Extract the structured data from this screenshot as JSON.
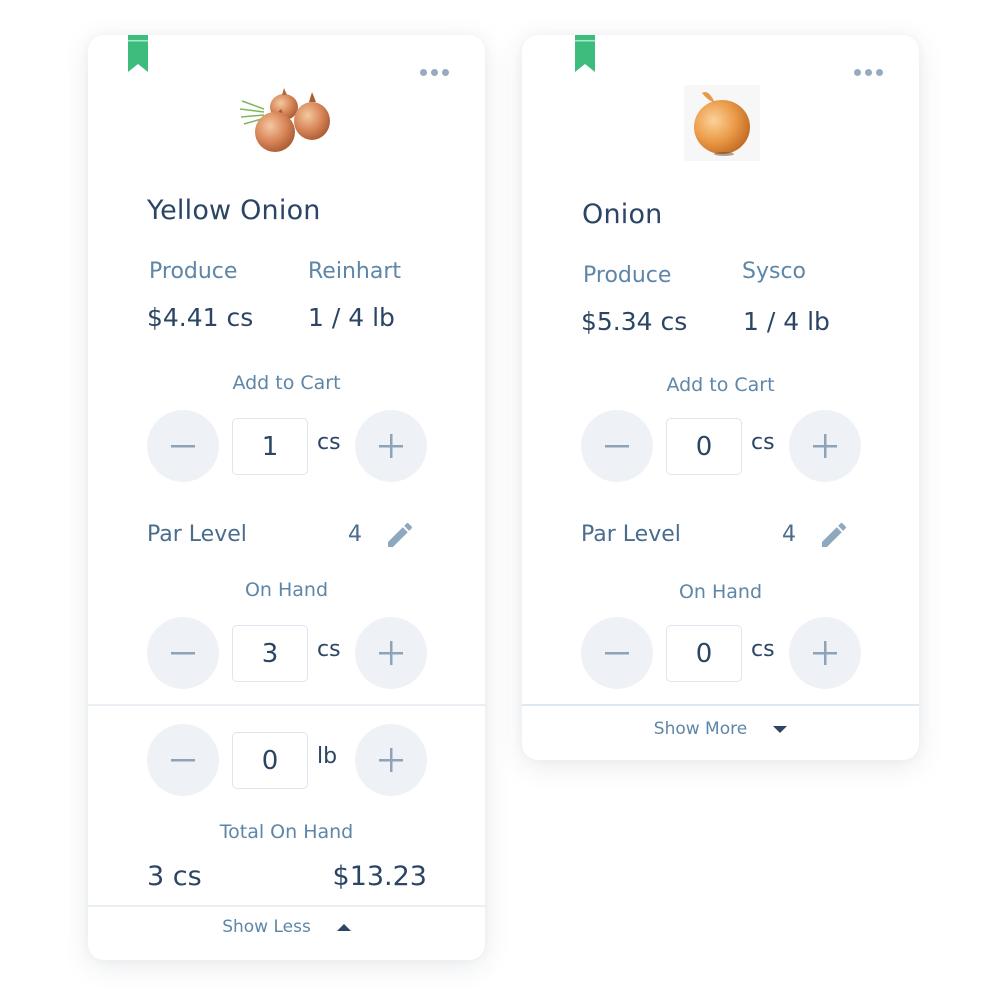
{
  "colors": {
    "bookmark": "#3dbd7d",
    "text_dark": "#2c4565",
    "text_label": "#5d86a8",
    "button_bg": "#eef2f6",
    "icon_muted": "#97abc0"
  },
  "cards": [
    {
      "name": "Yellow Onion",
      "category": "Produce",
      "vendor": "Reinhart",
      "price": "$4.41 cs",
      "pack_size": "1 / 4 lb",
      "add_to_cart": {
        "label": "Add to Cart",
        "value": "1",
        "unit": "cs"
      },
      "par_level": {
        "label": "Par Level",
        "value": "4"
      },
      "on_hand": {
        "label": "On Hand",
        "value": "3",
        "unit": "cs"
      },
      "on_hand_lb": {
        "value": "0",
        "unit": "lb"
      },
      "total_on_hand": {
        "label": "Total On Hand",
        "quantity": "3 cs",
        "value": "$13.23"
      },
      "toggle_label": "Show Less",
      "bookmarked": true
    },
    {
      "name": "Onion",
      "category": "Produce",
      "vendor": "Sysco",
      "price": "$5.34 cs",
      "pack_size": "1 / 4 lb",
      "add_to_cart": {
        "label": "Add to Cart",
        "value": "0",
        "unit": "cs"
      },
      "par_level": {
        "label": "Par Level",
        "value": "4"
      },
      "on_hand": {
        "label": "On Hand",
        "value": "0",
        "unit": "cs"
      },
      "toggle_label": "Show More",
      "bookmarked": true
    }
  ]
}
